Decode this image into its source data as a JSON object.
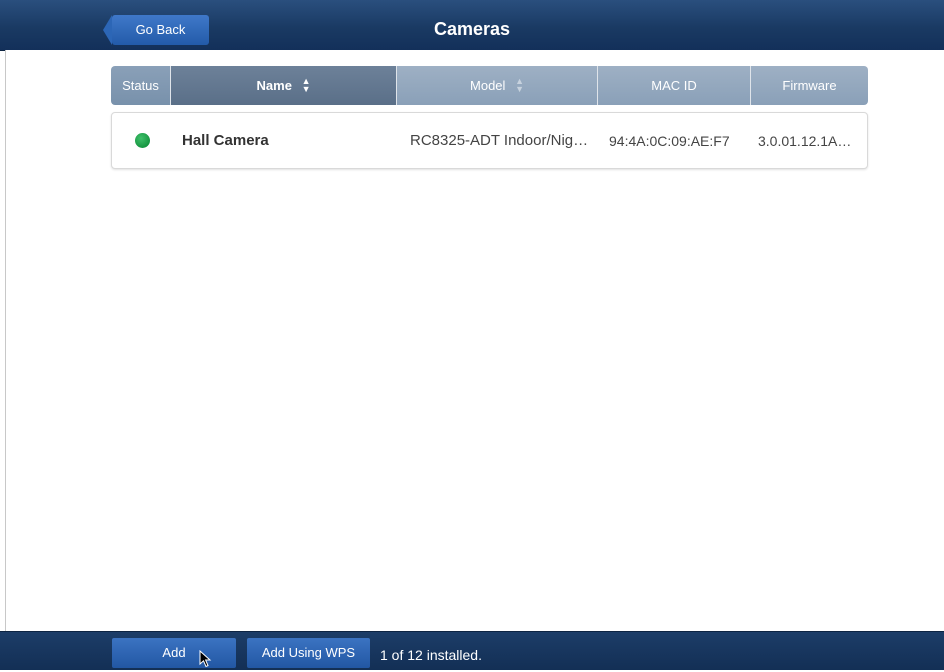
{
  "header": {
    "back_label": "Go Back",
    "title": "Cameras"
  },
  "table": {
    "columns": [
      {
        "label": "Status",
        "sortable": false
      },
      {
        "label": "Name",
        "sortable": true,
        "sort_active": true
      },
      {
        "label": "Model",
        "sortable": true,
        "sort_active": false
      },
      {
        "label": "MAC ID",
        "sortable": false
      },
      {
        "label": "Firmware",
        "sortable": false
      }
    ],
    "rows": [
      {
        "status": "online",
        "status_color": "#1f9e4a",
        "name": "Hall Camera",
        "model": "RC8325-ADT Indoor/Nig…",
        "mac": "94:4A:0C:09:AE:F7",
        "firmware": "3.0.01.12.1A…"
      }
    ]
  },
  "footer": {
    "add_label": "Add",
    "add_wps_label": "Add Using WPS",
    "installed_text": "1 of 12 installed."
  },
  "colors": {
    "header_bg": "#1a3a63",
    "button_blue": "#2c66b6",
    "column_header": "#8aa0b8",
    "active_column_header": "#5a6f88"
  }
}
